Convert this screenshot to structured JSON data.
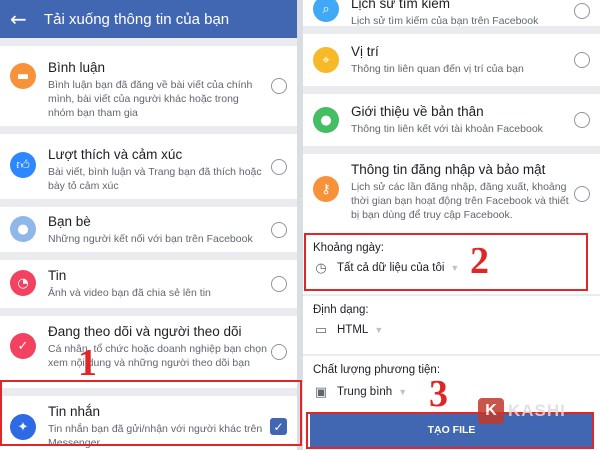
{
  "header": {
    "back_icon": "arrow-left-icon",
    "title": "Tải xuống thông tin của bạn"
  },
  "left_items": [
    {
      "title": "Bình luận",
      "desc": "Bình luận bạn đã đăng về bài viết của chính mình, bài viết của người khác hoặc trong nhóm bạn tham gia",
      "icon": "comment-icon",
      "color": "#f7923b",
      "selected": false
    },
    {
      "title": "Lượt thích và cảm xúc",
      "desc": "Bài viết, bình luận và Trang bạn đã thích hoặc bày tỏ cảm xúc",
      "icon": "like-icon",
      "color": "#2d88ff",
      "selected": false
    },
    {
      "title": "Bạn bè",
      "desc": "Những người kết nối với bạn trên Facebook",
      "icon": "friends-icon",
      "color": "#8fb8e8",
      "selected": false
    },
    {
      "title": "Tin",
      "desc": "Ảnh và video bạn đã chia sẻ lên tin",
      "icon": "stories-icon",
      "color": "#f3425f",
      "selected": false
    },
    {
      "title": "Đang theo dõi và người theo dõi",
      "desc": "Cá nhân, tổ chức hoặc doanh nghiệp bạn chọn xem nội dung và những người theo dõi bạn",
      "icon": "calendar-check-icon",
      "color": "#f3425f",
      "selected": false
    },
    {
      "title": "Tin nhắn",
      "desc": "Tin nhắn bạn đã gửi/nhận với người khác trên Messenger",
      "icon": "messenger-icon",
      "color": "#2d6ae3",
      "selected": true
    }
  ],
  "right_items": [
    {
      "title": "Lịch sử tìm kiếm",
      "desc": "Lịch sử tìm kiếm của bạn trên Facebook",
      "icon": "search-icon",
      "color": "#3fa9f5",
      "selected": false
    },
    {
      "title": "Vị trí",
      "desc": "Thông tin liên quan đến vị trí của bạn",
      "icon": "location-icon",
      "color": "#f7b928",
      "selected": false
    },
    {
      "title": "Giới thiệu về bản thân",
      "desc": "Thông tin liên kết với tài khoản Facebook",
      "icon": "profile-icon",
      "color": "#45bd62",
      "selected": false
    },
    {
      "title": "Thông tin đăng nhập và bảo mật",
      "desc": "Lịch sử các lần đăng nhập, đăng xuất, khoảng thời gian bạn hoạt động trên Facebook và thiết bị bạn dùng để truy cập Facebook.",
      "icon": "key-icon",
      "color": "#f7923b",
      "selected": false
    }
  ],
  "options": {
    "date_range": {
      "label": "Khoảng ngày:",
      "value": "Tất cả dữ liệu của tôi",
      "icon": "clock-icon"
    },
    "format": {
      "label": "Định dạng:",
      "value": "HTML",
      "icon": "folder-icon"
    },
    "media_quality": {
      "label": "Chất lượng phương tiện:",
      "value": "Trung bình",
      "icon": "video-icon"
    }
  },
  "create_button": "TẠO FILE",
  "annotations": {
    "step1": "1",
    "step2": "2",
    "step3": "3"
  },
  "watermark": {
    "letter": "K",
    "name": "KASHI"
  }
}
